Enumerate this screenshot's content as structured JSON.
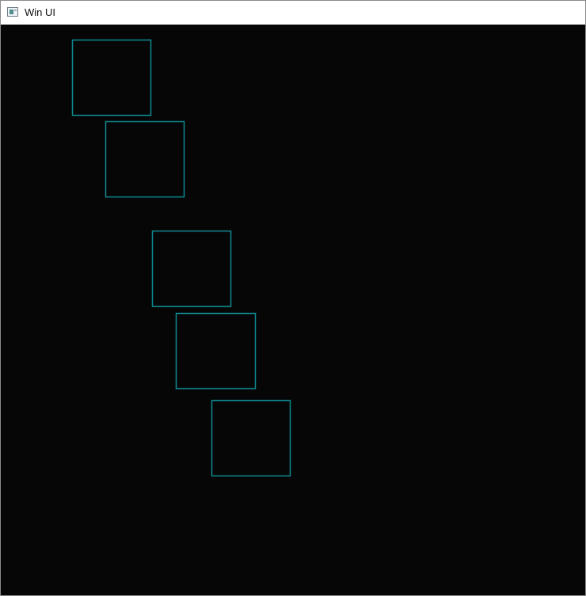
{
  "window": {
    "title": "Win UI",
    "icon": "app-window-icon"
  },
  "canvas": {
    "background_color": "#060606",
    "shape_stroke_color": "#0f8a92",
    "shape_count": 5,
    "shape_type": "outlined-square"
  }
}
